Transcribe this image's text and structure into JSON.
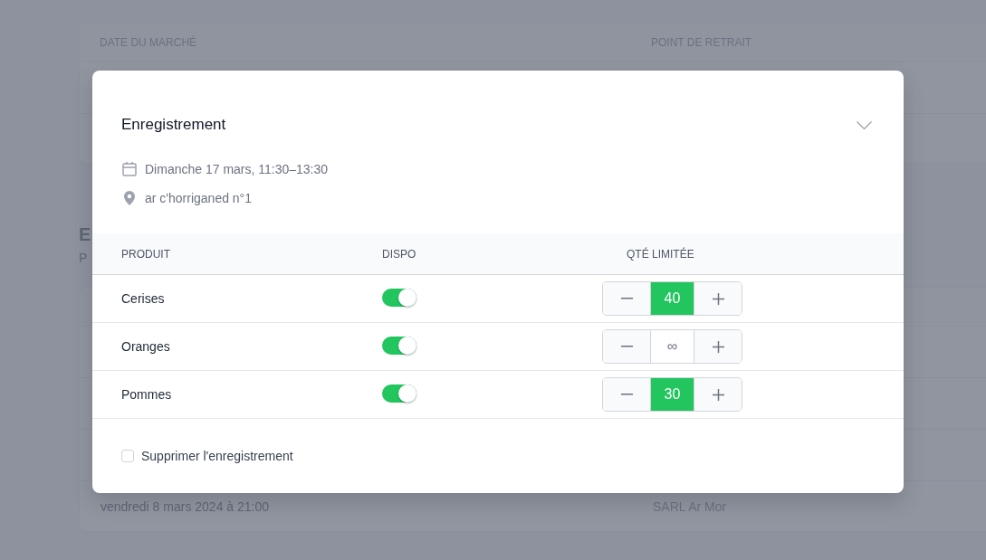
{
  "background": {
    "table": {
      "columns": [
        "DATE DU MARCHÉ",
        "POINT DE RETRAIT"
      ]
    },
    "section": {
      "title": "E",
      "subtitle": "P"
    },
    "rows": [
      {
        "date": "vendredi 8 mars 2024 à 21:00",
        "place": "SARL Ar Mor"
      }
    ]
  },
  "modal": {
    "title": "Enregistrement",
    "date": "Dimanche 17 mars, 11:30–13:30",
    "location": "ar c'horriganed n°1",
    "columns": [
      "PRODUIT",
      "DISPO",
      "QTÉ LIMITÉE"
    ],
    "products": [
      {
        "name": "Cerises",
        "available": true,
        "quantity": "40",
        "limited": true
      },
      {
        "name": "Oranges",
        "available": true,
        "quantity": "∞",
        "limited": false
      },
      {
        "name": "Pommes",
        "available": true,
        "quantity": "30",
        "limited": true
      }
    ],
    "delete": {
      "label": "Supprimer l'enregistrement",
      "checked": false
    }
  }
}
